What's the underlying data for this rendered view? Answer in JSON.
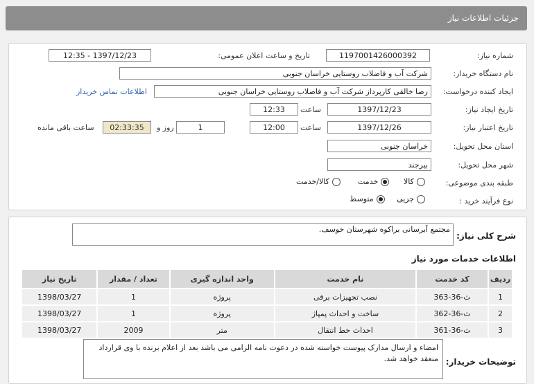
{
  "page_title": "جزئیات اطلاعات نیاز",
  "fields": {
    "need_number_label": "شماره نیاز:",
    "need_number": "1197001426000392",
    "announce_label": "تاریخ و ساعت اعلان عمومی:",
    "announce_value": "1397/12/23 - 12:35",
    "buyer_org_label": "نام دستگاه خریدار:",
    "buyer_org": "شرکت آب و فاضلاب روستایی خراسان جنوبی",
    "creator_label": "ایجاد کننده درخواست:",
    "creator": "رضا  خالقی کارپرداز شرکت آب و فاضلاب روستایی خراسان جنوبی",
    "contact_link": "اطلاعات تماس خریدار",
    "created_date_label": "تاریخ ایجاد نیاز:",
    "created_date": "1397/12/23",
    "time_label": "ساعت",
    "created_time": "12:33",
    "validity_label": "تاریخ اعتبار نیاز:",
    "validity_date": "1397/12/26",
    "validity_time": "12:00",
    "days_value": "1",
    "days_label": "روز و",
    "remaining_time": "02:33:35",
    "remaining_label": "ساعت باقی مانده",
    "province_label": "استان محل تحویل:",
    "province": "خراسان جنوبی",
    "city_label": "شهر محل تحویل:",
    "city": "بیرجند",
    "category_label": "طبقه بندی موضوعی:",
    "category_options": [
      "کالا",
      "خدمت",
      "کالا/خدمت"
    ],
    "purchase_type_label": "نوع فرآیند خرید :",
    "purchase_options": [
      "جزیی",
      "متوسط"
    ]
  },
  "general": {
    "label": "شرح کلی نیاز:",
    "value": "مجتمع آبرسانی براکوه شهرستان خوسف."
  },
  "services": {
    "title": "اطلاعات خدمات مورد نیاز",
    "headers": [
      "ردیف",
      "کد خدمت",
      "نام خدمت",
      "واحد اندازه گیری",
      "تعداد / مقدار",
      "تاریخ نیاز"
    ],
    "rows": [
      [
        "1",
        "ث-36-363",
        "نصب تجهیزات برقی",
        "پروژه",
        "1",
        "1398/03/27"
      ],
      [
        "2",
        "ث-36-362",
        "ساخت و احداث پمپاژ",
        "پروژه",
        "1",
        "1398/03/27"
      ],
      [
        "3",
        "ث-36-361",
        "احداث خط انتقال",
        "متر",
        "2009",
        "1398/03/27"
      ]
    ]
  },
  "buyer_notes": {
    "label": "توضیحات خریدار:",
    "value": "امضاء و ارسال مدارک پیوست خواسته شده در دعوت نامه الزامی می باشد بعد از اعلام برنده با وی قرارداد منعقد خواهد شد."
  }
}
